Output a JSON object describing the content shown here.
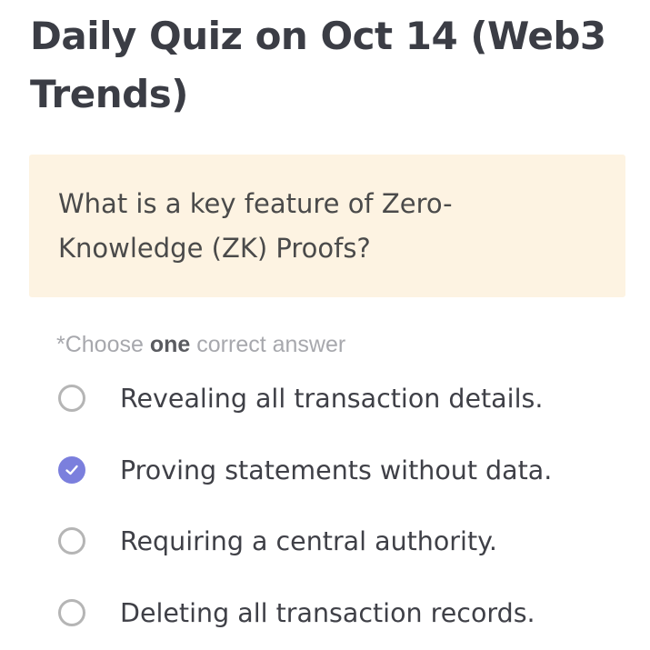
{
  "quiz": {
    "title": "Daily Quiz on Oct 14 (Web3 Trends)",
    "question": "What is a key feature of Zero-Knowledge (ZK) Proofs?",
    "instruction": {
      "prefix": "*Choose ",
      "emphasis": "one",
      "suffix": " correct answer"
    },
    "options": [
      {
        "label": "Revealing all transaction details.",
        "selected": false
      },
      {
        "label": "Proving statements without data.",
        "selected": true
      },
      {
        "label": "Requiring a central authority.",
        "selected": false
      },
      {
        "label": "Deleting all transaction records.",
        "selected": false
      }
    ]
  },
  "colors": {
    "title": "#3b3d45",
    "question_background": "#fdf3e2",
    "radio_selected": "#7b7fdd",
    "radio_unselected_border": "#b5b5b5",
    "instruction_muted": "#a7a8ad"
  }
}
